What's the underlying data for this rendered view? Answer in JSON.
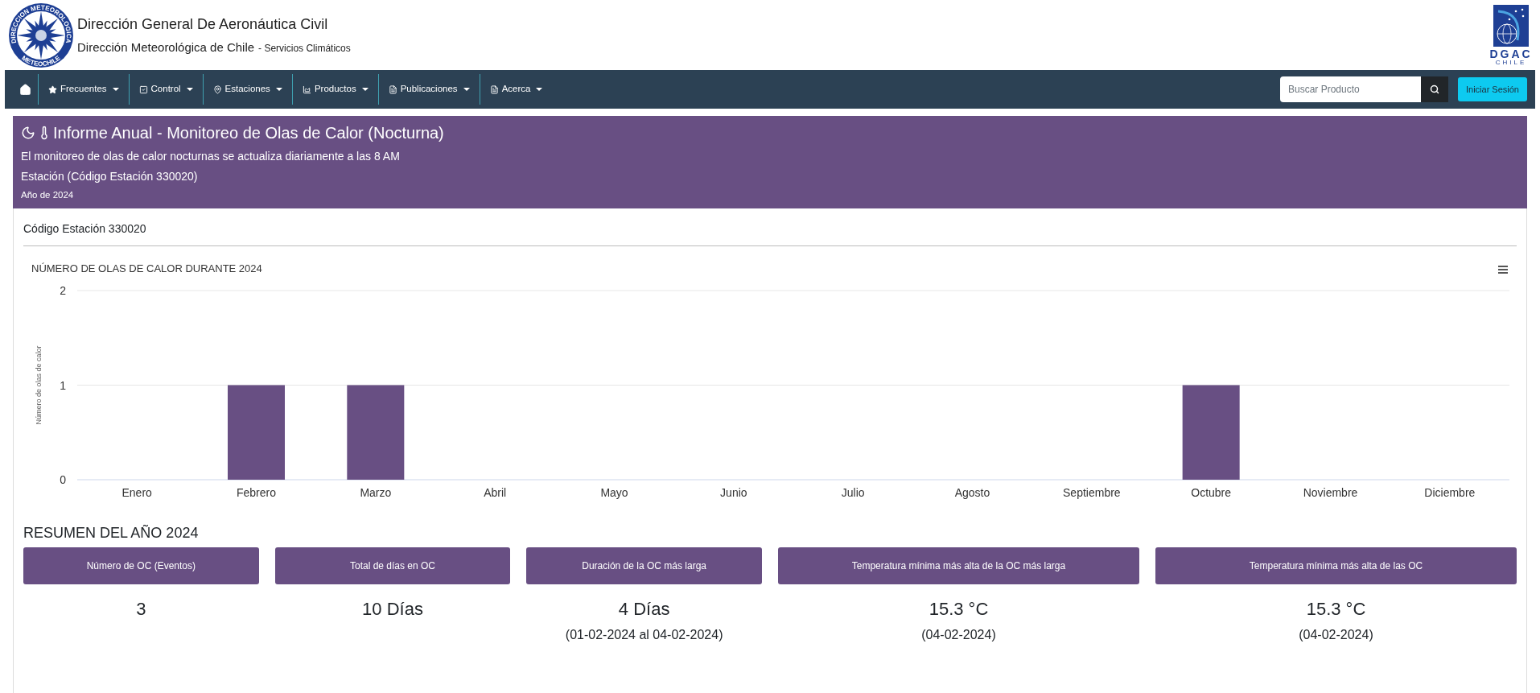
{
  "header": {
    "logo_text_top": "DIRECCION METEOROLOGICA",
    "logo_text_bottom": "METEOCHILE",
    "title": "Dirección General De Aeronáutica Civil",
    "subtitle": "Dirección Meteorológica de Chile",
    "subtitle_suffix": "- Servicios Climáticos",
    "right_logo_text": "DGAC",
    "right_logo_subtext": "CHILE"
  },
  "nav": {
    "items": [
      {
        "label": "Frecuentes"
      },
      {
        "label": "Control"
      },
      {
        "label": "Estaciones"
      },
      {
        "label": "Productos"
      },
      {
        "label": "Publicaciones"
      },
      {
        "label": "Acerca"
      }
    ],
    "search": {
      "placeholder": "Buscar Producto"
    },
    "login": "Iniciar Sesión"
  },
  "banner": {
    "title": "Informe Anual - Monitoreo de Olas de Calor (Nocturna)",
    "lines": [
      "El monitoreo de olas de calor nocturnas se actualiza diariamente a las 8 AM",
      "Estación (Código Estación 330020)"
    ],
    "year": "Año de 2024"
  },
  "station": "Código Estación 330020",
  "chart_data": {
    "type": "bar",
    "title": "NÚMERO DE OLAS DE CALOR DURANTE 2024",
    "ylabel": "Número de olas de calor",
    "categories": [
      "Enero",
      "Febrero",
      "Marzo",
      "Abril",
      "Mayo",
      "Junio",
      "Julio",
      "Agosto",
      "Septiembre",
      "Octubre",
      "Noviembre",
      "Diciembre"
    ],
    "series": [
      {
        "color": "#684f83",
        "values": [
          0,
          1,
          1,
          0,
          0,
          0,
          0,
          0,
          0,
          1,
          0,
          0
        ]
      }
    ],
    "ylim": [
      0,
      2
    ],
    "yticks": [
      0,
      1,
      2
    ]
  },
  "summary": {
    "title": "RESUMEN DEL AÑO 2024",
    "cards": [
      {
        "label": "Número de OC (Eventos)",
        "value": "3"
      },
      {
        "label": "Total de días en OC",
        "value": "10 Días"
      },
      {
        "label": "Duración de la OC más larga",
        "value": "4 Días",
        "detail": "(01-02-2024 al 04-02-2024)"
      },
      {
        "label": "Temperatura mínima más alta de la OC más larga",
        "value": "15.3 °C",
        "detail": "(04-02-2024)"
      },
      {
        "label": "Temperatura mínima más alta de las OC",
        "value": "15.3 °C",
        "detail": "(04-02-2024)"
      }
    ]
  }
}
